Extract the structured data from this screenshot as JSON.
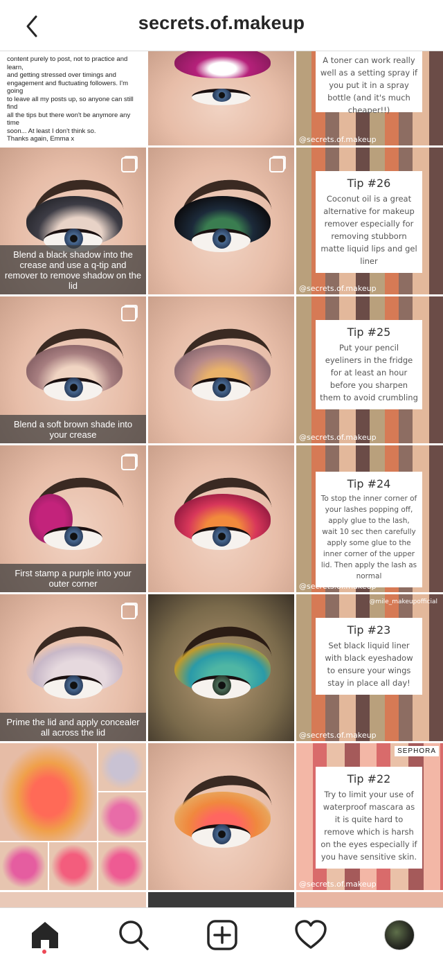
{
  "header": {
    "title": "secrets.of.makeup"
  },
  "text_post": {
    "lines": [
      "content purely to post, not to practice and learn,",
      "and getting stressed over timings and",
      "engagement and fluctuating followers. I'm going",
      "to leave all my posts up, so anyone can still find",
      "all the tips but there won't be anymore any time",
      "soon... At least I don't think so.",
      "Thanks again, Emma x"
    ]
  },
  "grid": {
    "row1_tip": {
      "body": "A toner can work really well as a setting spray if you put it in a spray bottle (and it's much cheaper!!)",
      "watermark": "@secrets.of.makeup"
    },
    "row2": {
      "caption": "Blend a black shadow into the crease and use a q-tip and remover to remove shadow on the lid",
      "tip_title": "Tip #26",
      "tip_body": "Coconut oil is a great alternative for makeup remover especially for removing stubborn matte liquid lips and gel liner",
      "watermark": "@secrets.of.makeup"
    },
    "row3": {
      "caption": "Blend a soft brown shade into your crease",
      "tip_title": "Tip #25",
      "tip_body": "Put your pencil eyeliners in the fridge for at least an hour before you sharpen them to avoid crumbling",
      "watermark": "@secrets.of.makeup"
    },
    "row4": {
      "caption": "First stamp a purple into your outer corner",
      "tip_title": "Tip #24",
      "tip_body": "To stop the inner corner of your lashes popping off, apply glue to the lash, wait 10 sec then carefully apply some glue to the inner corner of the upper lid. Then apply the lash as normal",
      "watermark": "@secrets.of.makeup"
    },
    "row5": {
      "caption": "Prime the lid and apply concealer all across the lid",
      "tip_title": "Tip #23",
      "tip_body": "Set black liquid liner with black eyeshadow to ensure your wings stay in place all day!",
      "watermark": "@secrets.of.makeup",
      "corner_tag": "@mile_makeupofficial"
    },
    "row6": {
      "tip_title": "Tip #22",
      "tip_body": "Try to limit your use of waterproof mascara as it is quite hard to remove which is harsh on the eyes especially if you have sensitive skin.",
      "watermark": "@secrets.of.makeup",
      "brand_tag": "SEPHORA"
    }
  },
  "nav": {
    "items": [
      "home-icon",
      "search-icon",
      "new-post-icon",
      "activity-icon",
      "profile-avatar"
    ],
    "active": "home-icon",
    "accent": "#ed4956"
  }
}
